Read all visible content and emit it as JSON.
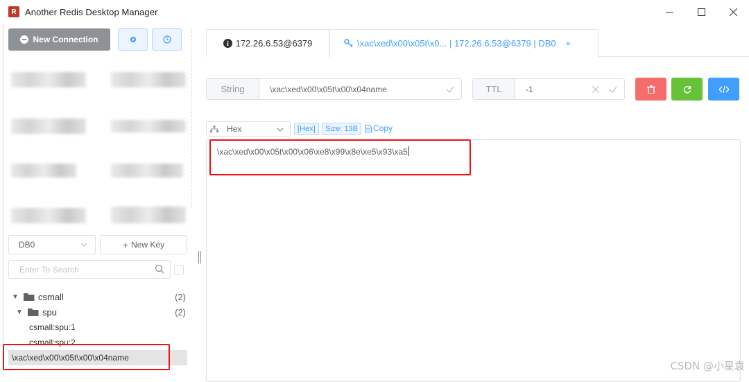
{
  "window": {
    "title": "Another Redis Desktop Manager",
    "minimize": "—",
    "maximize": "☐",
    "close": "✕"
  },
  "sidebar": {
    "new_connection_label": "New Connection",
    "db_select": "DB0",
    "new_key_label": "New Key",
    "search_placeholder": "Enter To Search",
    "tree": [
      {
        "label": "csmall",
        "count": "(2)"
      },
      {
        "label": "spu",
        "count": "(2)"
      },
      {
        "label": "csmall:spu:1"
      },
      {
        "label": "csmall:spu:2"
      }
    ],
    "selected_key": "\\xac\\xed\\x00\\x05t\\x00\\x04name"
  },
  "tabs": [
    {
      "label": "172.26.6.53@6379",
      "icon": "info-icon"
    },
    {
      "label": "\\xac\\xed\\x00\\x05t\\x0... | 172.26.6.53@6379 | DB0",
      "icon": "key-icon",
      "close": "×"
    }
  ],
  "key_detail": {
    "type_label": "String",
    "key_name": "\\xac\\xed\\x00\\x05t\\x00\\x04name",
    "ttl_label": "TTL",
    "ttl_value": "-1"
  },
  "viewer": {
    "format": "Hex",
    "hex_tag": "[Hex]",
    "size_tag": "Size: 13B",
    "copy_label": "Copy",
    "content": "\\xac\\xed\\x00\\x05t\\x00\\x06\\xe8\\x99\\x8e\\xe5\\x93\\xa5"
  },
  "watermark": "CSDN @小星袁",
  "colors": {
    "delete": "#f56c6c",
    "refresh": "#67c23a",
    "code": "#409eff",
    "accent": "#409eff",
    "highlight_box": "#e11111"
  }
}
